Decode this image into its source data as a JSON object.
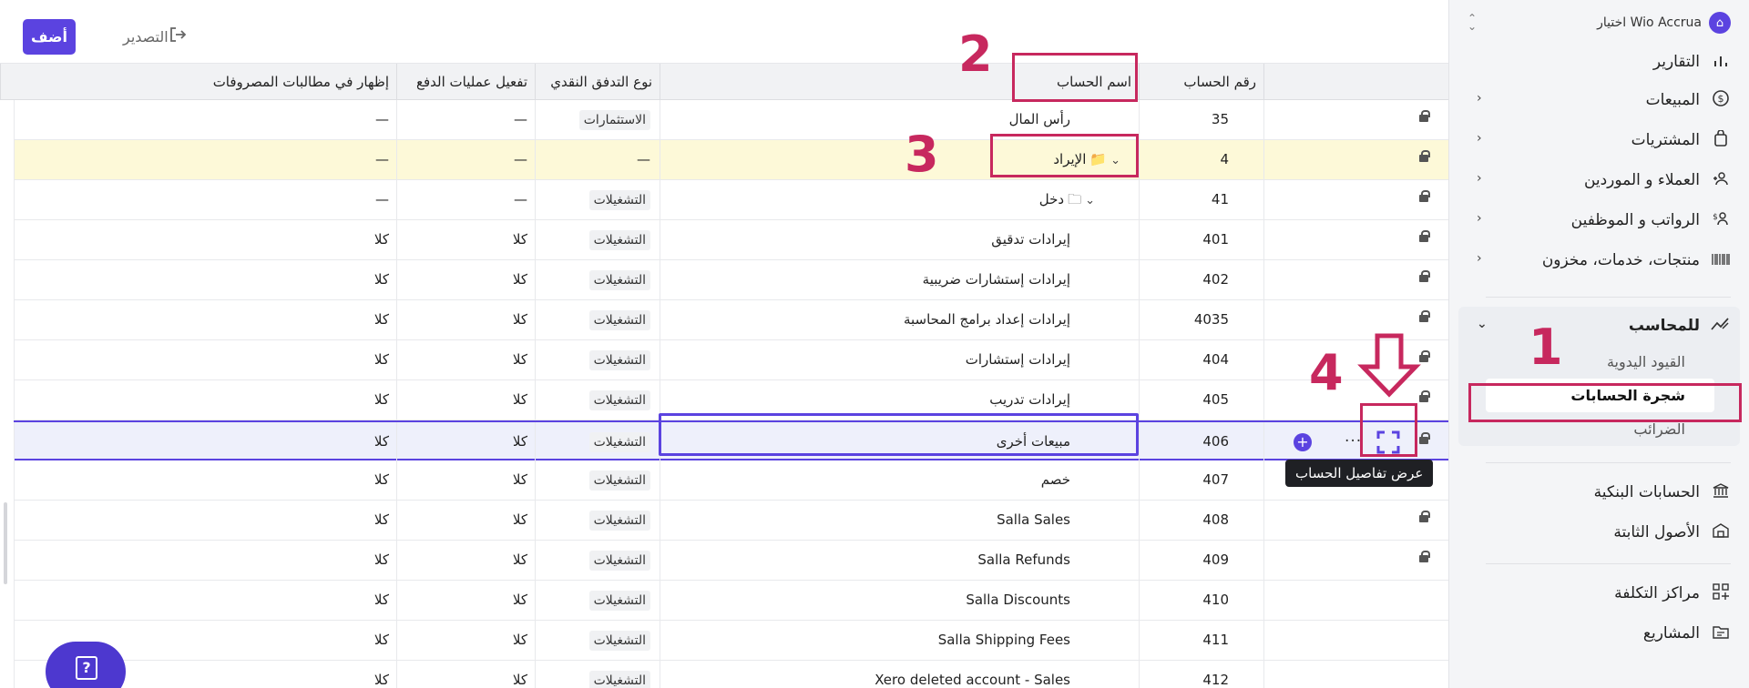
{
  "org": {
    "name": "Wio Accrua اختيار"
  },
  "sidebar": {
    "items": [
      {
        "label": "التقارير",
        "icon": "bar-chart-icon"
      },
      {
        "label": "المبيعات",
        "icon": "dollar-circle-icon"
      },
      {
        "label": "المشتريات",
        "icon": "shopping-bag-icon"
      },
      {
        "label": "العملاء و الموردين",
        "icon": "users-icon"
      },
      {
        "label": "الرواتب و الموظفين",
        "icon": "payroll-icon"
      },
      {
        "label": "منتجات، خدمات، مخزون",
        "icon": "barcode-icon"
      }
    ],
    "accountant": {
      "label": "للمحاسب",
      "sub": [
        "القيود اليدوية",
        "شجرة الحسابات",
        "الضرائب"
      ]
    },
    "items2": [
      {
        "label": "الحسابات البنكية",
        "icon": "bank-icon"
      },
      {
        "label": "الأصول الثابتة",
        "icon": "building-icon"
      }
    ],
    "items3": [
      {
        "label": "مراكز التكلفة",
        "icon": "grid-plus-icon"
      },
      {
        "label": "المشاريع",
        "icon": "folder-icon"
      }
    ]
  },
  "toolbar": {
    "add_label": "أضف",
    "export_label": "التصدير"
  },
  "table": {
    "headers": {
      "number": "رقم الحساب",
      "name": "اسم الحساب",
      "flow": "نوع التدفق النقدي",
      "payments": "تفعيل عمليات الدفع",
      "expense": "إظهار في مطالبات المصروفات"
    },
    "rows": [
      {
        "number": "35",
        "name": "رأس المال",
        "flow": "الاستثمارات",
        "payments": "—",
        "expense": "—",
        "locked": true
      },
      {
        "number": "4",
        "name": "الإيراد",
        "flow": "—",
        "payments": "—",
        "expense": "—",
        "locked": true
      },
      {
        "number": "41",
        "name": "دخل",
        "flow": "التشغيلات",
        "payments": "—",
        "expense": "—",
        "locked": true
      },
      {
        "number": "401",
        "name": "إيرادات تدقيق",
        "flow": "التشغيلات",
        "payments": "كلا",
        "expense": "كلا",
        "locked": true
      },
      {
        "number": "402",
        "name": "إيرادات إستشارات ضريبية",
        "flow": "التشغيلات",
        "payments": "كلا",
        "expense": "كلا",
        "locked": true
      },
      {
        "number": "4035",
        "name": "إيرادات إعداد برامج المحاسبة",
        "flow": "التشغيلات",
        "payments": "كلا",
        "expense": "كلا",
        "locked": true
      },
      {
        "number": "404",
        "name": "إيرادات إستشارات",
        "flow": "التشغيلات",
        "payments": "كلا",
        "expense": "كلا",
        "locked": true
      },
      {
        "number": "405",
        "name": "إيرادات تدريب",
        "flow": "التشغيلات",
        "payments": "كلا",
        "expense": "كلا",
        "locked": true
      },
      {
        "number": "406",
        "name": "مبيعات أخرى",
        "flow": "التشغيلات",
        "payments": "كلا",
        "expense": "كلا",
        "locked": true
      },
      {
        "number": "407",
        "name": "خصم",
        "flow": "التشغيلات",
        "payments": "كلا",
        "expense": "كلا",
        "locked": false
      },
      {
        "number": "408",
        "name": "Salla Sales",
        "flow": "التشغيلات",
        "payments": "كلا",
        "expense": "كلا",
        "locked": true
      },
      {
        "number": "409",
        "name": "Salla Refunds",
        "flow": "التشغيلات",
        "payments": "كلا",
        "expense": "كلا",
        "locked": true
      },
      {
        "number": "410",
        "name": "Salla Discounts",
        "flow": "التشغيلات",
        "payments": "كلا",
        "expense": "كلا",
        "locked": false
      },
      {
        "number": "411",
        "name": "Salla Shipping Fees",
        "flow": "التشغيلات",
        "payments": "كلا",
        "expense": "كلا",
        "locked": false
      },
      {
        "number": "412",
        "name": "Xero deleted account - Sales",
        "flow": "التشغيلات",
        "payments": "كلا",
        "expense": "كلا",
        "locked": false
      }
    ]
  },
  "tooltip": "عرض تفاصيل الحساب",
  "annotations": [
    "1",
    "2",
    "3",
    "4"
  ]
}
